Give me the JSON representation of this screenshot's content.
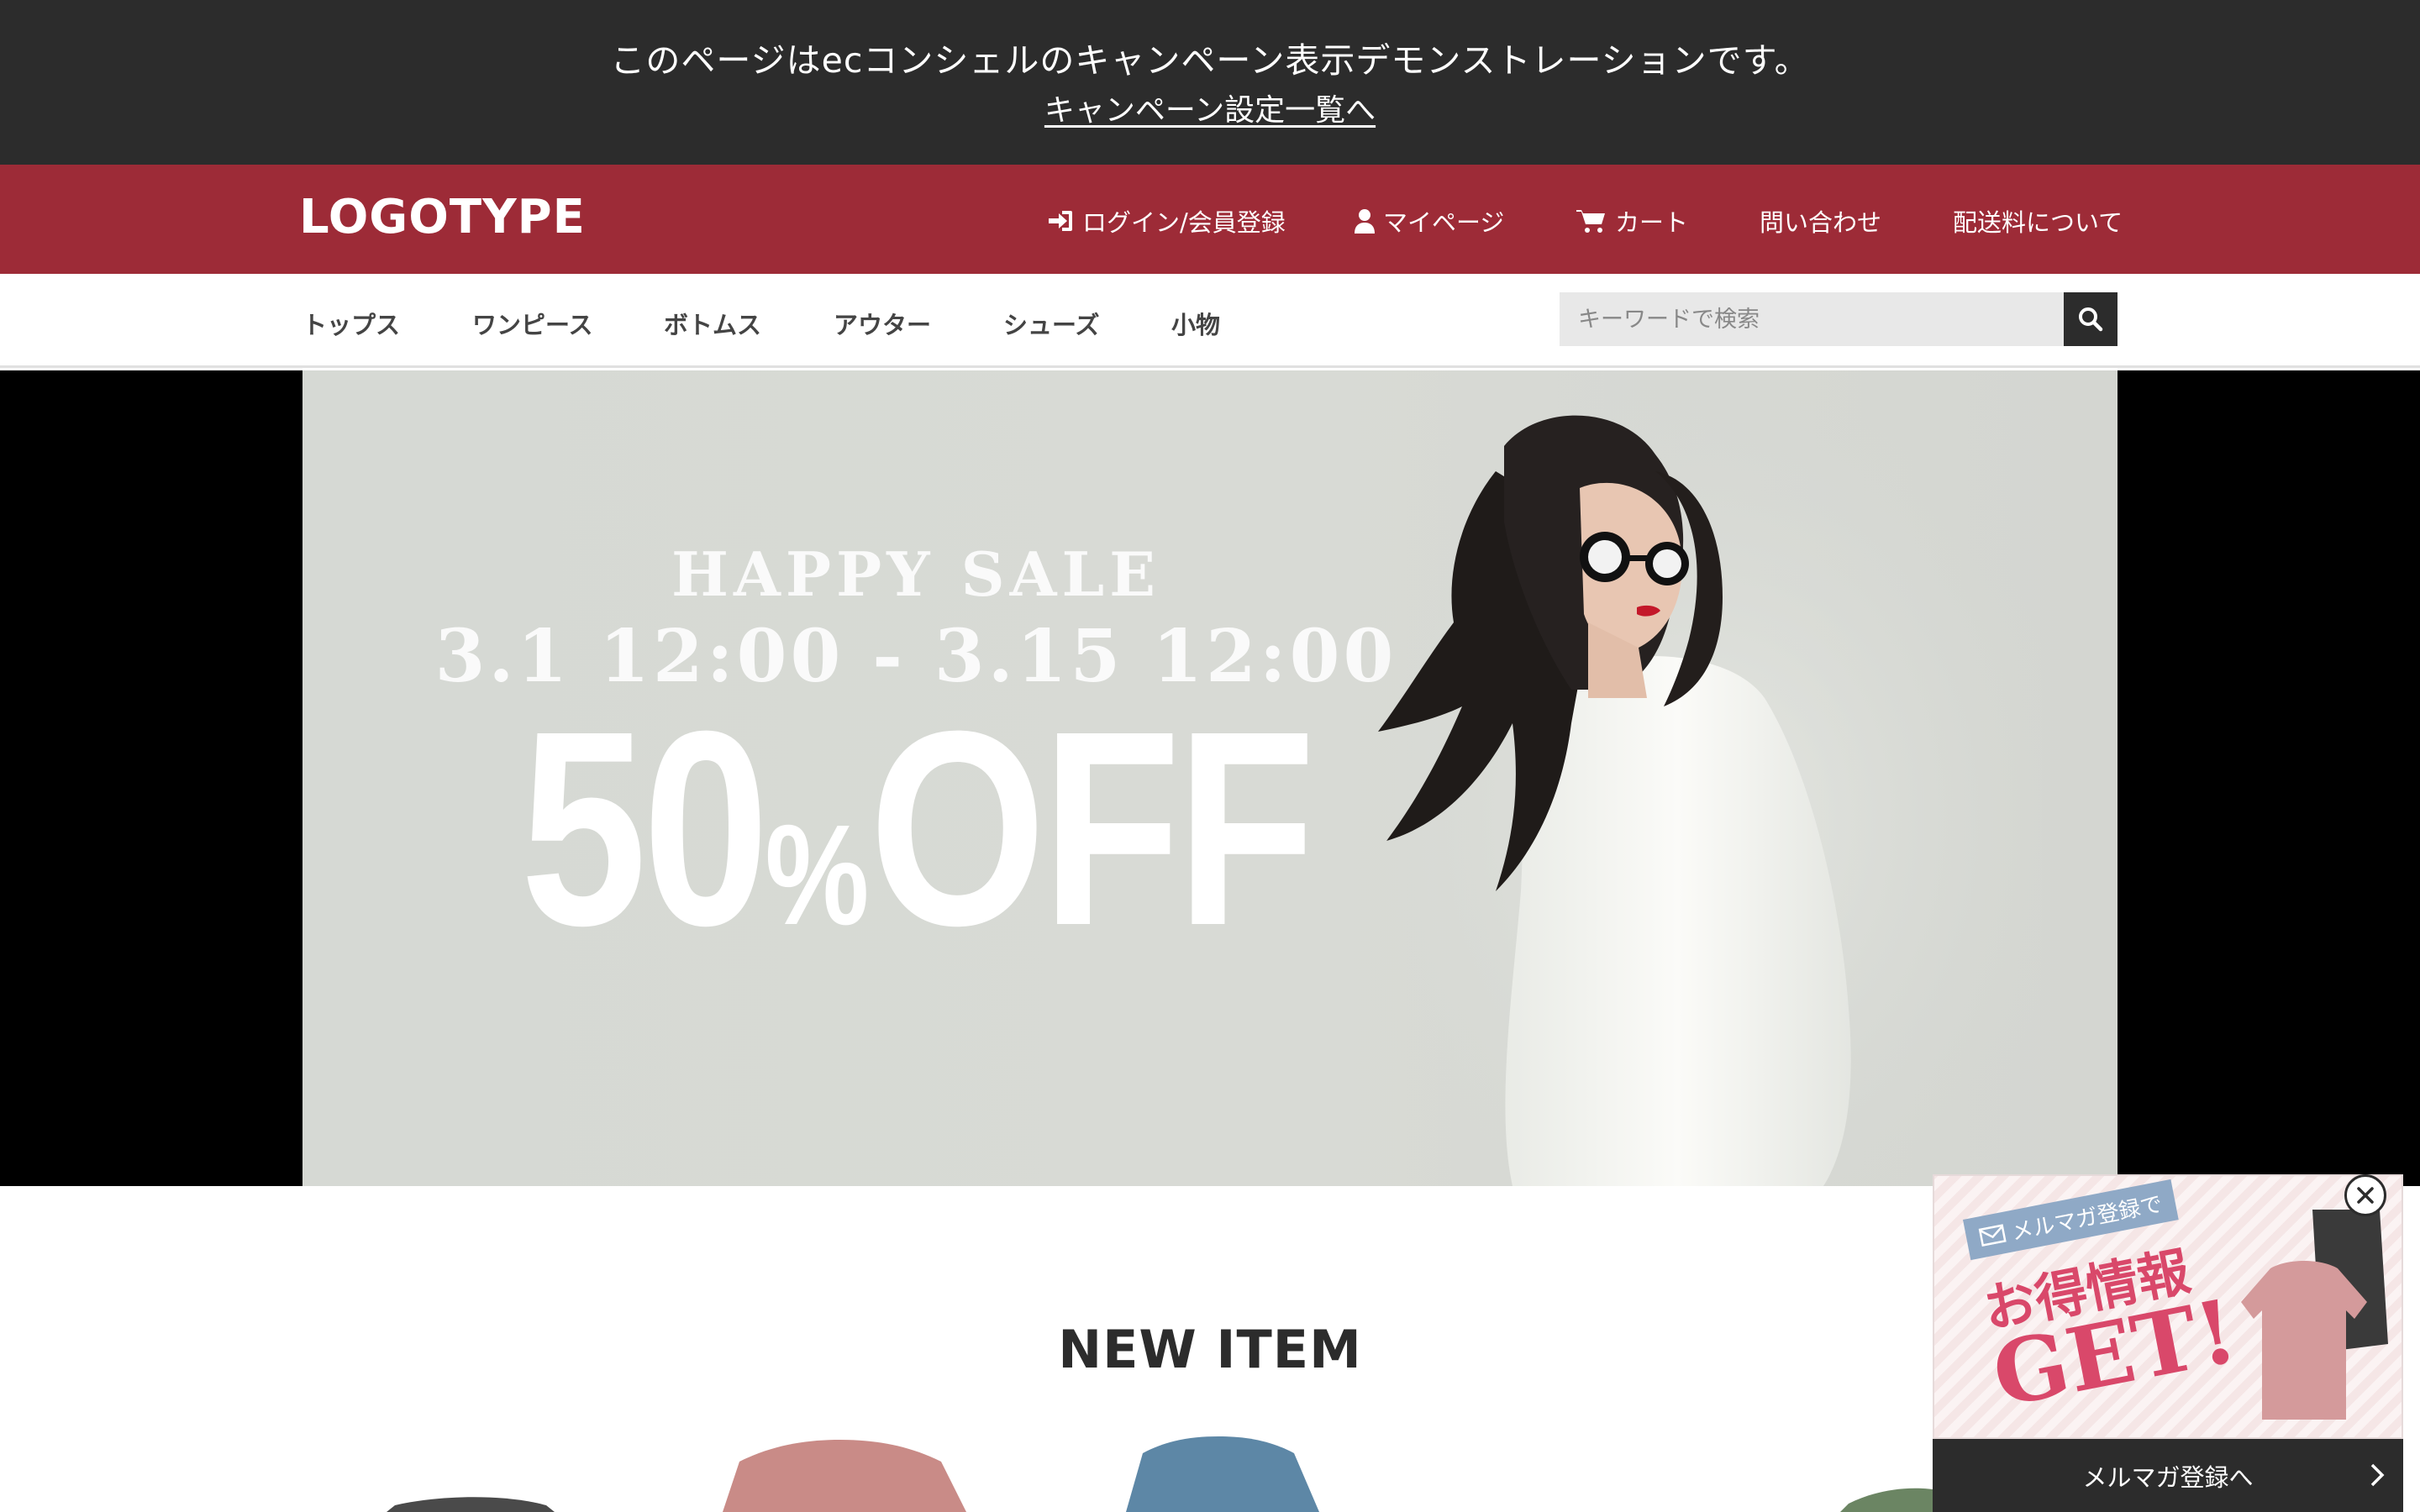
{
  "demo_banner": {
    "message": "このページはecコンシェルのキャンペーン表示デモンストレーションです。",
    "link": "キャンペーン設定一覧へ"
  },
  "header": {
    "logo": "LOGOTYPE",
    "nav": {
      "login": "ログイン/会員登録",
      "mypage": "マイページ",
      "cart": "カート",
      "contact": "問い合わせ",
      "shipping": "配送料について"
    }
  },
  "categories": {
    "tops": "トップス",
    "onepiece": "ワンピース",
    "bottoms": "ボトムス",
    "outer": "アウター",
    "shoes": "シューズ",
    "accessories": "小物"
  },
  "search": {
    "placeholder": "キーワードで検索"
  },
  "hero": {
    "headline": "HAPPY SALE",
    "dates": "3.1 12:00 - 3.15 12:00",
    "discount_number": "50",
    "discount_symbol": "%",
    "discount_word": "OFF"
  },
  "new_items": {
    "title": "NEW ITEM"
  },
  "popup": {
    "tag": "メルマガ登録で",
    "line1": "お得情報",
    "line2": "GET!",
    "cta": "メルマガ登録へ"
  },
  "colors": {
    "demo_bar": "#2c2c2c",
    "header_red": "#9d2b37",
    "hero_bg": "#d7d9d4",
    "popup_pink": "#d9486a",
    "popup_tag_blue": "#8fa9c6"
  }
}
